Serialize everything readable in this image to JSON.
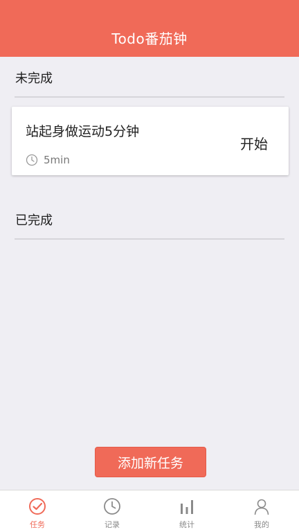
{
  "header": {
    "title": "Todo番茄钟"
  },
  "sections": {
    "incomplete_title": "未完成",
    "complete_title": "已完成"
  },
  "tasks": [
    {
      "name": "站起身做运动5分钟",
      "duration": "5min",
      "action": "开始"
    }
  ],
  "add_button": {
    "label": "添加新任务"
  },
  "tabbar": {
    "tabs": [
      {
        "label": "任务",
        "icon": "check-circle-icon",
        "active": true
      },
      {
        "label": "记录",
        "icon": "clock-icon",
        "active": false
      },
      {
        "label": "统计",
        "icon": "bar-chart-icon",
        "active": false
      },
      {
        "label": "我的",
        "icon": "user-icon",
        "active": false
      }
    ]
  },
  "colors": {
    "accent": "#f06a58",
    "background": "#efeef3",
    "inactive_tab": "#888888"
  }
}
